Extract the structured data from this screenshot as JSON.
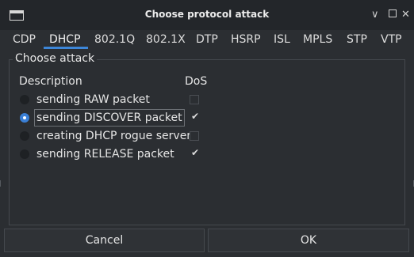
{
  "window": {
    "title": "Choose protocol attack",
    "minimize_glyph": "∨",
    "close_glyph": "✕"
  },
  "tabs": [
    {
      "label": "CDP"
    },
    {
      "label": "DHCP",
      "active": true
    },
    {
      "label": "802.1Q"
    },
    {
      "label": "802.1X"
    },
    {
      "label": "DTP"
    },
    {
      "label": "HSRP"
    },
    {
      "label": "ISL"
    },
    {
      "label": "MPLS"
    },
    {
      "label": "STP"
    },
    {
      "label": "VTP"
    }
  ],
  "group": {
    "legend": "Choose attack",
    "description_header": "Description",
    "dos_header": "DoS",
    "attacks": [
      {
        "label": "sending RAW packet",
        "selected": false,
        "dos": false
      },
      {
        "label": "sending DISCOVER packet",
        "selected": true,
        "dos": true
      },
      {
        "label": "creating DHCP rogue server",
        "selected": false,
        "dos": false
      },
      {
        "label": "sending RELEASE packet",
        "selected": false,
        "dos": true
      }
    ]
  },
  "buttons": {
    "cancel": "Cancel",
    "ok": "OK"
  },
  "colors": {
    "accent": "#3d86d8",
    "background": "#2b2e32",
    "titlebar": "#23262a"
  }
}
